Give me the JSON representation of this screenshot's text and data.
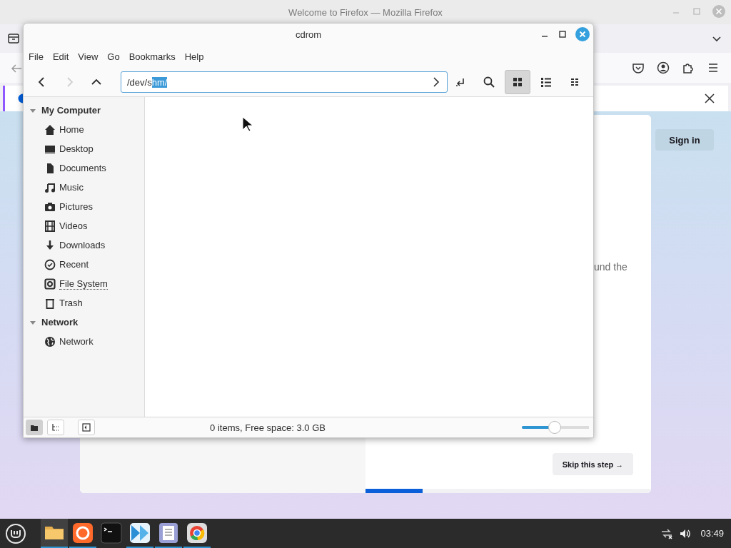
{
  "browser": {
    "title": "Welcome to Firefox — Mozilla Firefox",
    "card_text": "und the",
    "skip_button": "Skip this step →",
    "progress": {
      "level": 0.2
    },
    "sign_in_button": "Sign in"
  },
  "file_manager": {
    "title": "cdrom",
    "menu": [
      "File",
      "Edit",
      "View",
      "Go",
      "Bookmarks",
      "Help"
    ],
    "nav_buttons": [
      {
        "kind": "back",
        "disabled": false
      },
      {
        "kind": "forward",
        "disabled": true
      },
      {
        "kind": "up",
        "disabled": false
      }
    ],
    "location": {
      "typed": "/dev/s",
      "selected_text": "hm/"
    },
    "view_buttons": [
      {
        "kind": "icons",
        "selected": true
      },
      {
        "kind": "list",
        "selected": false
      },
      {
        "kind": "compact",
        "selected": false
      }
    ],
    "sidebar": [
      {
        "label": "My Computer",
        "expanded": true,
        "children": [
          {
            "label": "Home",
            "kind": "home",
            "focused": false
          },
          {
            "label": "Desktop",
            "kind": "desktop",
            "focused": false
          },
          {
            "label": "Documents",
            "kind": "document",
            "focused": false
          },
          {
            "label": "Music",
            "kind": "music",
            "focused": false
          },
          {
            "label": "Pictures",
            "kind": "camera",
            "focused": false
          },
          {
            "label": "Videos",
            "kind": "film",
            "focused": false
          },
          {
            "label": "Downloads",
            "kind": "download",
            "focused": false
          },
          {
            "label": "Recent",
            "kind": "clock",
            "focused": false
          },
          {
            "label": "File System",
            "kind": "disk",
            "focused": true
          },
          {
            "label": "Trash",
            "kind": "trash",
            "focused": false
          }
        ]
      },
      {
        "label": "Network",
        "expanded": true,
        "children": [
          {
            "label": "Network",
            "kind": "globe",
            "focused": false
          }
        ]
      }
    ],
    "pane_buttons": [
      {
        "kind": "places",
        "selected": true
      },
      {
        "kind": "tree",
        "selected": false
      }
    ],
    "status": "0 items, Free space: 3.0 GB",
    "zoom": {
      "level": 0.49
    }
  },
  "taskbar": {
    "apps": [
      {
        "kind": "files",
        "selected": true,
        "running": true
      },
      {
        "kind": "firefox",
        "selected": false,
        "running": true
      },
      {
        "kind": "terminal",
        "selected": false,
        "running": false
      },
      {
        "kind": "media",
        "selected": false,
        "running": true
      },
      {
        "kind": "editor",
        "selected": false,
        "running": true
      },
      {
        "kind": "chrome",
        "selected": false,
        "running": true
      }
    ],
    "clock": "03:49"
  }
}
